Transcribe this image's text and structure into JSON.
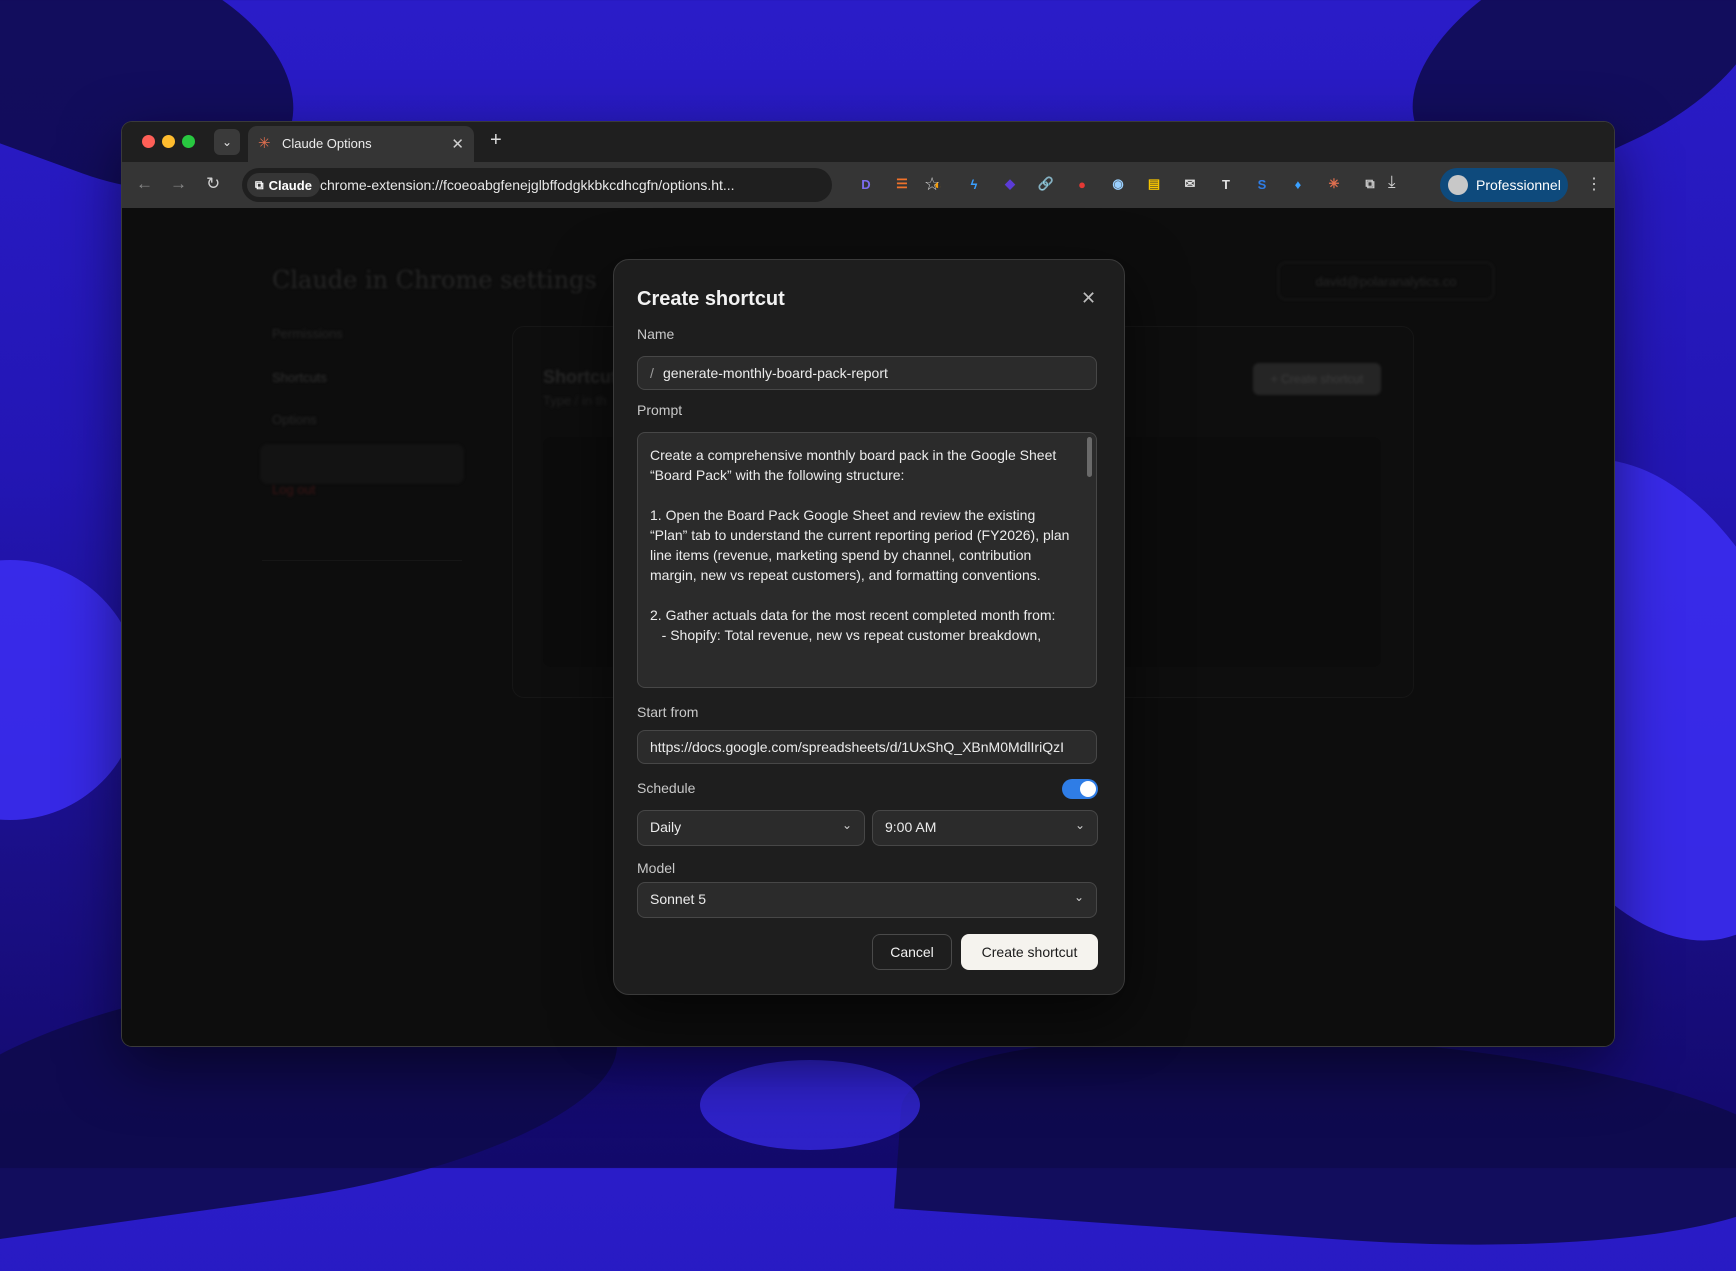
{
  "browser": {
    "tab_title": "Claude Options",
    "omnibox_chip": "Claude",
    "url": "chrome-extension://fcoeoabgfenejglbffodgkkbkcdhcgfn/options.ht...",
    "profile_label": "Professionnel",
    "extensions": [
      {
        "icon": "D",
        "color": "#7c6cf0"
      },
      {
        "icon": "☰",
        "color": "#f0722b"
      },
      {
        "icon": "◐",
        "color": "#f59e0b"
      },
      {
        "icon": "ϟ",
        "color": "#3aa0ff"
      },
      {
        "icon": "◆",
        "color": "#5b3bd6"
      },
      {
        "icon": "🔗",
        "color": "#7aa2ff"
      },
      {
        "icon": "●",
        "color": "#e53935"
      },
      {
        "icon": "◉",
        "color": "#9ad0ff"
      },
      {
        "icon": "▤",
        "color": "#f5c400"
      },
      {
        "icon": "✉",
        "color": "#e0e0e0"
      },
      {
        "icon": "T",
        "color": "#e0e0e0"
      },
      {
        "icon": "S",
        "color": "#2f7de6"
      },
      {
        "icon": "♦",
        "color": "#3aa0ff"
      },
      {
        "icon": "✳",
        "color": "#e06f4f"
      },
      {
        "icon": "⧉",
        "color": "#d0d0d0"
      }
    ]
  },
  "background_page": {
    "title": "Claude in Chrome settings",
    "account": "david@polaranalytics.co",
    "sidebar": [
      "Permissions",
      "Shortcuts",
      "Options"
    ],
    "logout": "Log out",
    "card_title": "Shortcuts",
    "card_subtitle": "Type / in th",
    "card_button": "+ Create shortcut"
  },
  "modal": {
    "title": "Create shortcut",
    "name_label": "Name",
    "name_prefix": "/",
    "name_value": "generate-monthly-board-pack-report",
    "prompt_label": "Prompt",
    "prompt_value": "Create a comprehensive monthly board pack in the Google Sheet “Board Pack” with the following structure:\n\n1. Open the Board Pack Google Sheet and review the existing “Plan” tab to understand the current reporting period (FY2026), plan line items (revenue, marketing spend by channel, contribution margin, new vs repeat customers), and formatting conventions.\n\n2. Gather actuals data for the most recent completed month from:\n   - Shopify: Total revenue, new vs repeat customer breakdown,",
    "start_label": "Start from",
    "start_value": "https://docs.google.com/spreadsheets/d/1UxShQ_XBnM0MdlIriQzI",
    "schedule_label": "Schedule",
    "schedule_enabled": true,
    "frequency": "Daily",
    "time": "9:00 AM",
    "model_label": "Model",
    "model": "Sonnet 5",
    "cancel": "Cancel",
    "create": "Create shortcut"
  }
}
